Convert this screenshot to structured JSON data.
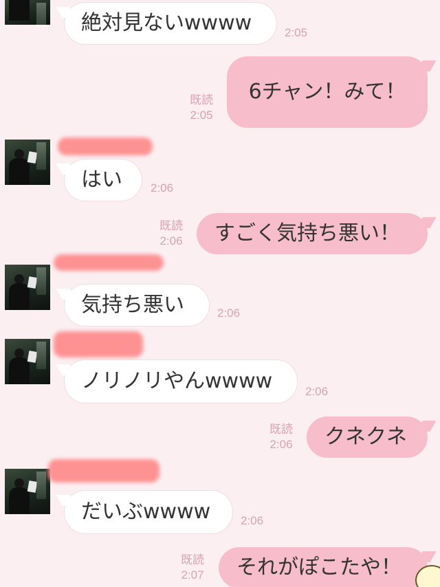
{
  "messages": [
    {
      "id": 1,
      "side": "in",
      "text": "絶対見ないwwww",
      "time": "2:05"
    },
    {
      "id": 2,
      "side": "out",
      "text": "6チャン！みて！",
      "read": "既読",
      "time": "2:05"
    },
    {
      "id": 3,
      "side": "in",
      "text": "はい",
      "time": "2:06"
    },
    {
      "id": 4,
      "side": "out",
      "text": "すごく気持ち悪い！",
      "read": "既読",
      "time": "2:06"
    },
    {
      "id": 5,
      "side": "in",
      "text": "気持ち悪い",
      "time": "2:06"
    },
    {
      "id": 6,
      "side": "in",
      "text": "ノリノリやんwwww",
      "time": "2:06"
    },
    {
      "id": 7,
      "side": "out",
      "text": "クネクネ",
      "read": "既読",
      "time": "2:06"
    },
    {
      "id": 8,
      "side": "in",
      "text": "だいぶwwww",
      "time": "2:06"
    },
    {
      "id": 9,
      "side": "out",
      "text": "それがぽこたや！",
      "read": "既読",
      "time": "2:07"
    }
  ],
  "colors": {
    "background": "#fbeff2",
    "incoming_bubble": "#ffffff",
    "outgoing_bubble": "#f7bdcb",
    "meta_text": "#d6a3b0",
    "redaction": "#ff8d8d"
  }
}
